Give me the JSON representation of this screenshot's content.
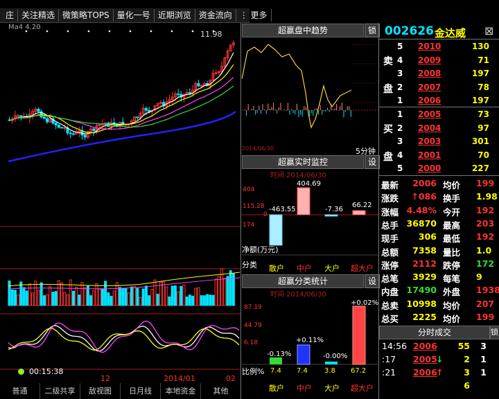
{
  "toolbar": {
    "items": [
      "庄",
      "关注精选",
      "微策略TOPS",
      "量化一号",
      "近期浏览",
      "资金流向",
      "⋮ 更多"
    ]
  },
  "kline": {
    "legend": "Ma4 4.20",
    "price_high": "11.98",
    "time": "00:15:38",
    "date_labels": [
      "12",
      "2014/01",
      "02"
    ],
    "bottom_tabs": [
      "普通",
      "二级共享",
      "敌视图",
      "日月线",
      "本地资金",
      "其他"
    ]
  },
  "intraday": {
    "title": "超赢盘中趋势",
    "lock_label": "锁",
    "period": "5分钟",
    "date_stamp": "2014/06/30"
  },
  "monitor": {
    "title": "超赢实时监控",
    "set_label": "设",
    "subtitle": "时间  2014/06/30",
    "yaxis": [
      "404",
      "115.28",
      "174",
      "0"
    ],
    "values": [
      "-463.55",
      "404.69",
      "-7.36",
      "66.22"
    ],
    "net_label": "净额(万元)",
    "cat_label": "分类",
    "categories": [
      "散户",
      "中户",
      "大户",
      "超大户"
    ]
  },
  "classify": {
    "title": "超赢分类统计",
    "set_label": "设",
    "subtitle": "时间  2014/06/30",
    "yaxis": [
      "87.19",
      "44.79",
      "6.18"
    ],
    "pcts": [
      "-0.13%",
      "+0.11%",
      "-0.00%",
      "+0.02%"
    ],
    "ratio_label": "比例%",
    "ratios": [
      "7.4",
      "7.4",
      "3.8",
      "67.2"
    ],
    "categories": [
      "散户",
      "中户",
      "大户",
      "超大户"
    ]
  },
  "quote": {
    "code": "002626",
    "name": "金达威",
    "close_icon": "⊠"
  },
  "orderbook": {
    "sell_label_1": "卖",
    "sell_label_2": "盘",
    "buy_label_1": "买",
    "buy_label_2": "盘",
    "sell": [
      {
        "level": "5",
        "price": "2010",
        "vol": "130"
      },
      {
        "level": "4",
        "price": "2009",
        "vol": "71"
      },
      {
        "level": "3",
        "price": "2008",
        "vol": "197"
      },
      {
        "level": "2",
        "price": "2007",
        "vol": "78"
      },
      {
        "level": "1",
        "price": "2006",
        "vol": "197"
      }
    ],
    "buy": [
      {
        "level": "1",
        "price": "2005",
        "vol": "73"
      },
      {
        "level": "2",
        "price": "2004",
        "vol": "97"
      },
      {
        "level": "3",
        "price": "2003",
        "vol": "301"
      },
      {
        "level": "4",
        "price": "2001",
        "vol": "70"
      },
      {
        "level": "5",
        "price": "2000",
        "vol": "227"
      }
    ]
  },
  "stats": [
    {
      "k1": "最新",
      "v1": "2006",
      "c1": "red",
      "k2": "均价",
      "v2": "199",
      "c2": "red"
    },
    {
      "k1": "涨跌",
      "v1": "↑086",
      "c1": "red",
      "k2": "换手",
      "v2": "1.98",
      "c2": "yellow"
    },
    {
      "k1": "涨幅",
      "v1": "4.48%",
      "c1": "red",
      "k2": "今开",
      "v2": "192",
      "c2": "red"
    },
    {
      "k1": "总手",
      "v1": "36870",
      "c1": "yellow",
      "k2": "最高",
      "v2": "203",
      "c2": "red"
    },
    {
      "k1": "现手",
      "v1": "306",
      "c1": "yellow",
      "k2": "最低",
      "v2": "192",
      "c2": "red"
    },
    {
      "k1": "总额",
      "v1": "7358",
      "c1": "yellow",
      "k2": "量比",
      "v2": "1.0",
      "c2": "yellow"
    },
    {
      "k1": "涨停",
      "v1": "2112",
      "c1": "red",
      "k2": "跌停",
      "v2": "172",
      "c2": "green"
    },
    {
      "k1": "总笔",
      "v1": "3929",
      "c1": "yellow",
      "k2": "每笔",
      "v2": "9",
      "c2": "yellow"
    },
    {
      "k1": "内盘",
      "v1": "17490",
      "c1": "green",
      "k2": "外盘",
      "v2": "1938",
      "c2": "red"
    },
    {
      "k1": "总卖",
      "v1": "10998",
      "c1": "yellow",
      "k2": "均价",
      "v2": "207",
      "c2": "red"
    },
    {
      "k1": "总买",
      "v1": "2225",
      "c1": "yellow",
      "k2": "均价",
      "v2": "199",
      "c2": "red"
    }
  ],
  "ticks": {
    "header": "分时成交",
    "side_label": "锁",
    "rows": [
      {
        "time": "14:56",
        "price": "2006",
        "vol": "55",
        "n": "3",
        "arrow": ""
      },
      {
        "time": ":17",
        "price": "2005",
        "vol": "2",
        "n": "1",
        "arrow": "↓"
      },
      {
        "time": ":21",
        "price": "2006",
        "vol": "3",
        "n": "1",
        "arrow": "↑"
      },
      {
        "time": "",
        "price": "",
        "vol": "6",
        "n": "",
        "arrow": ""
      }
    ]
  },
  "colors": {
    "up": "#ff3333",
    "down": "#33dd33",
    "ma_blue": "#1a1aff",
    "accent": "#00e5ff"
  }
}
